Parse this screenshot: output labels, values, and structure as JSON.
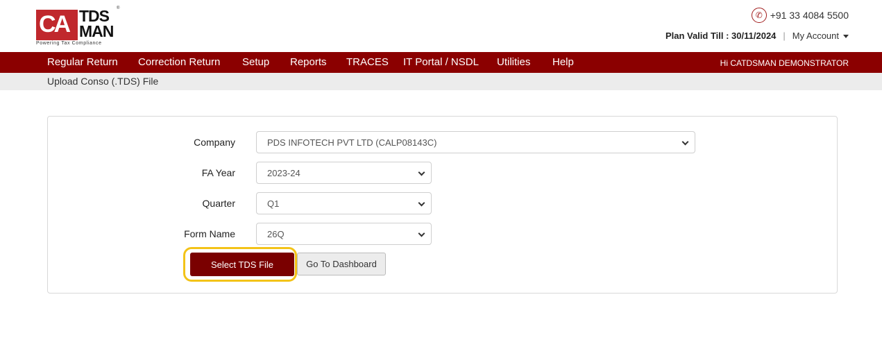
{
  "header": {
    "logo": {
      "mark": "CA",
      "brand_line1": "TDS",
      "brand_line2": "MAN",
      "tagline": "Powering Tax Compliance",
      "registered": "®"
    },
    "phone": "+91 33 4084 5500",
    "plan_valid": "Plan Valid Till : 30/11/2024",
    "separator": "|",
    "account_label": "My Account",
    "icons": {
      "phone": "phone-icon",
      "account_caret": "caret-down-icon"
    }
  },
  "nav": {
    "items": [
      "Regular Return",
      "Correction Return",
      "Setup",
      "Reports",
      "TRACES",
      "IT Portal / NSDL",
      "Utilities",
      "Help"
    ],
    "greeting": "Hi CATDSMAN DEMONSTRATOR",
    "color": "#8b0000"
  },
  "breadcrumb": {
    "title": "Upload Conso (.TDS) File"
  },
  "form": {
    "company": {
      "label": "Company",
      "value": "PDS INFOTECH PVT LTD (CALP08143C)"
    },
    "fa_year": {
      "label": "FA Year",
      "value": "2023-24"
    },
    "quarter": {
      "label": "Quarter",
      "value": "Q1"
    },
    "form_name": {
      "label": "Form Name",
      "value": "26Q"
    }
  },
  "buttons": {
    "select_tds": "Select TDS File",
    "dashboard": "Go To Dashboard"
  },
  "colors": {
    "primary": "#7a0000",
    "highlight": "#f3c318"
  }
}
